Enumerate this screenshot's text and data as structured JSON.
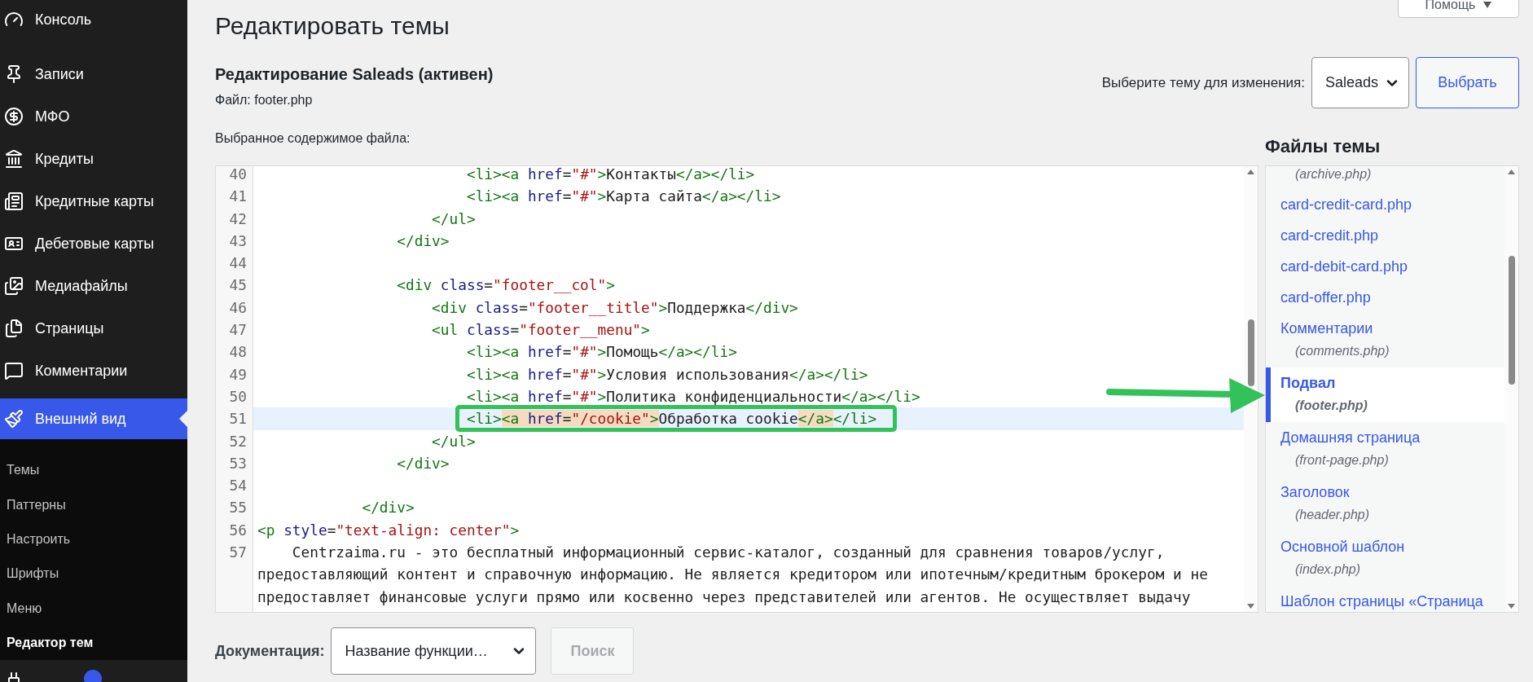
{
  "sidebar": {
    "items": [
      {
        "label": "Консоль",
        "selected": false
      },
      {
        "label": "Записи",
        "selected": false
      },
      {
        "label": "МФО",
        "selected": false
      },
      {
        "label": "Кредиты",
        "selected": false
      },
      {
        "label": "Кредитные карты",
        "selected": false
      },
      {
        "label": "Дебетовые карты",
        "selected": false
      },
      {
        "label": "Медиафайлы",
        "selected": false
      },
      {
        "label": "Страницы",
        "selected": false
      },
      {
        "label": "Комментарии",
        "selected": false
      },
      {
        "label": "Внешний вид",
        "selected": true,
        "children": [
          {
            "label": "Темы",
            "selected": false
          },
          {
            "label": "Паттерны",
            "selected": false
          },
          {
            "label": "Настроить",
            "selected": false
          },
          {
            "label": "Шрифты",
            "selected": false
          },
          {
            "label": "Меню",
            "selected": false
          },
          {
            "label": "Редактор тем",
            "selected": true
          }
        ]
      },
      {
        "selected": false,
        "badge": true
      }
    ]
  },
  "help_button": {
    "label": "Помощь"
  },
  "page_title": "Редактировать темы",
  "editing_title": "Редактирование Saleads (активен)",
  "file_label": "Файл: footer.php",
  "theme_picker": {
    "label": "Выберите тему для изменения:",
    "value": "Saleads",
    "button": "Выбрать"
  },
  "content_label": "Выбранное содержимое файла:",
  "editor": {
    "lines": [
      {
        "number": "40",
        "tokens": [
          {
            "kind": "tag",
            "text": "                        <li><a "
          },
          {
            "kind": "attr",
            "text": "href"
          },
          {
            "kind": "text",
            "text": "="
          },
          {
            "kind": "string",
            "text": "\"#\""
          },
          {
            "kind": "tag",
            "text": ">"
          },
          {
            "kind": "text",
            "text": "Контакты"
          },
          {
            "kind": "tag",
            "text": "</a></li>"
          }
        ]
      },
      {
        "number": "41",
        "tokens": [
          {
            "kind": "tag",
            "text": "                        <li><a "
          },
          {
            "kind": "attr",
            "text": "href"
          },
          {
            "kind": "text",
            "text": "="
          },
          {
            "kind": "string",
            "text": "\"#\""
          },
          {
            "kind": "tag",
            "text": ">"
          },
          {
            "kind": "text",
            "text": "Карта сайта"
          },
          {
            "kind": "tag",
            "text": "</a></li>"
          }
        ]
      },
      {
        "number": "42",
        "tokens": [
          {
            "kind": "tag",
            "text": "                    </ul>"
          }
        ]
      },
      {
        "number": "43",
        "tokens": [
          {
            "kind": "tag",
            "text": "                </div>"
          }
        ]
      },
      {
        "number": "44"
      },
      {
        "number": "45",
        "tokens": [
          {
            "kind": "tag",
            "text": "                <div "
          },
          {
            "kind": "attr",
            "text": "class"
          },
          {
            "kind": "text",
            "text": "="
          },
          {
            "kind": "string",
            "text": "\"footer__col\""
          },
          {
            "kind": "tag",
            "text": ">"
          }
        ]
      },
      {
        "number": "46",
        "tokens": [
          {
            "kind": "tag",
            "text": "                    <div "
          },
          {
            "kind": "attr",
            "text": "class"
          },
          {
            "kind": "text",
            "text": "="
          },
          {
            "kind": "string",
            "text": "\"footer__title\""
          },
          {
            "kind": "tag",
            "text": ">"
          },
          {
            "kind": "text",
            "text": "Поддержка"
          },
          {
            "kind": "tag",
            "text": "</div>"
          }
        ]
      },
      {
        "number": "47",
        "tokens": [
          {
            "kind": "tag",
            "text": "                    <ul "
          },
          {
            "kind": "attr",
            "text": "class"
          },
          {
            "kind": "text",
            "text": "="
          },
          {
            "kind": "string",
            "text": "\"footer__menu\""
          },
          {
            "kind": "tag",
            "text": ">"
          }
        ]
      },
      {
        "number": "48",
        "tokens": [
          {
            "kind": "tag",
            "text": "                        <li><a "
          },
          {
            "kind": "attr",
            "text": "href"
          },
          {
            "kind": "text",
            "text": "="
          },
          {
            "kind": "string",
            "text": "\"#\""
          },
          {
            "kind": "tag",
            "text": ">"
          },
          {
            "kind": "text",
            "text": "Помощь"
          },
          {
            "kind": "tag",
            "text": "</a></li>"
          }
        ]
      },
      {
        "number": "49",
        "tokens": [
          {
            "kind": "tag",
            "text": "                        <li><a "
          },
          {
            "kind": "attr",
            "text": "href"
          },
          {
            "kind": "text",
            "text": "="
          },
          {
            "kind": "string",
            "text": "\"#\""
          },
          {
            "kind": "tag",
            "text": ">"
          },
          {
            "kind": "text",
            "text": "Условия использования"
          },
          {
            "kind": "tag",
            "text": "</a></li>"
          }
        ]
      },
      {
        "number": "50",
        "tokens": [
          {
            "kind": "tag",
            "text": "                        <li><a "
          },
          {
            "kind": "attr",
            "text": "href"
          },
          {
            "kind": "text",
            "text": "="
          },
          {
            "kind": "string",
            "text": "\"#\""
          },
          {
            "kind": "tag",
            "text": ">"
          },
          {
            "kind": "text",
            "text": "Политика конфиденциальности"
          },
          {
            "kind": "tag",
            "text": "</a></li>"
          }
        ]
      },
      {
        "number": "51",
        "active": true,
        "tokens": [
          {
            "kind": "tag",
            "text": "                        <li>"
          },
          {
            "kind": "tag",
            "text": "<a ",
            "match": true
          },
          {
            "kind": "attr",
            "text": "href",
            "match": true
          },
          {
            "kind": "text",
            "text": "=",
            "match": true
          },
          {
            "kind": "string",
            "text": "\"/cookie\"",
            "match": true
          },
          {
            "kind": "tag",
            "text": ">",
            "match": true
          },
          {
            "kind": "text",
            "text": "Обработка cookie"
          },
          {
            "kind": "tag",
            "text": "</a>",
            "match": true
          },
          {
            "kind": "tag",
            "text": "</li>"
          }
        ]
      },
      {
        "number": "52",
        "tokens": [
          {
            "kind": "tag",
            "text": "                    </ul>"
          }
        ]
      },
      {
        "number": "53",
        "tokens": [
          {
            "kind": "tag",
            "text": "                </div>"
          }
        ]
      },
      {
        "number": "54"
      },
      {
        "number": "55",
        "tokens": [
          {
            "kind": "tag",
            "text": "            </div>"
          }
        ]
      },
      {
        "number": "56",
        "tokens": [
          {
            "kind": "tag",
            "text": "<p "
          },
          {
            "kind": "attr",
            "text": "style"
          },
          {
            "kind": "text",
            "text": "="
          },
          {
            "kind": "string",
            "text": "\"text-align: center\""
          },
          {
            "kind": "tag",
            "text": ">"
          }
        ]
      },
      {
        "number": "57",
        "tokens": [
          {
            "kind": "text",
            "text": "    Centrzaima.ru - это бесплатный информационный сервис-каталог, созданный для сравнения товаров/услуг,"
          }
        ],
        "wrap": [
          "предоставляющий контент и справочную информацию. Не является кредитором или ипотечным/кредитным брокером и не",
          "предоставляет финансовые услуги прямо или косвенно через представителей или агентов. Не осуществляет выдачу"
        ]
      }
    ]
  },
  "files": {
    "title": "Файлы темы",
    "items": [
      {
        "file": "(archive.php)",
        "selected": false
      },
      {
        "label": "card-credit-card.php",
        "selected": false
      },
      {
        "label": "card-credit.php",
        "selected": false
      },
      {
        "label": "card-debit-card.php",
        "selected": false
      },
      {
        "label": "card-offer.php",
        "selected": false
      },
      {
        "label": "Комментарии",
        "file": "(comments.php)",
        "selected": false
      },
      {
        "label": "Подвал",
        "file": "(footer.php)",
        "selected": true
      },
      {
        "label": "Домашняя страница",
        "file": "(front-page.php)",
        "selected": false
      },
      {
        "label": "Заголовок",
        "file": "(header.php)",
        "selected": false
      },
      {
        "label": "Основной шаблон",
        "file": "(index.php)",
        "selected": false
      },
      {
        "label": "Шаблон страницы «Страница",
        "selected": false
      }
    ]
  },
  "documentation": {
    "label": "Документация:",
    "value": "Название функции…",
    "button": "Поиск",
    "button_disabled": true
  }
}
